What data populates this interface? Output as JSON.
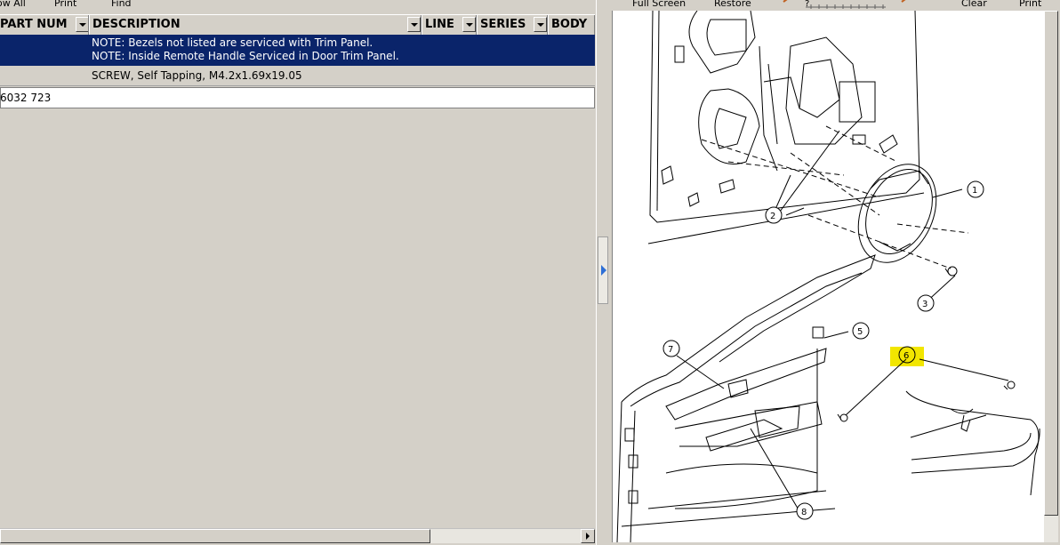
{
  "left_toolbar": {
    "show_all": "ow All",
    "print": "Print",
    "find": "Find"
  },
  "grid": {
    "columns": [
      "PART NUM",
      "DESCRIPTION",
      "LINE",
      "SERIES",
      "BODY"
    ],
    "rows": [
      {
        "part_num": "",
        "description_lines": [
          "NOTE: Bezels not listed are serviced with Trim Panel.",
          "NOTE: Inside Remote Handle Serviced in Door Trim Panel."
        ],
        "selected": true
      },
      {
        "part_num": "",
        "description_lines": [
          "SCREW, Self Tapping, M4.2x1.69x19.05"
        ],
        "selected": false
      }
    ],
    "input_value": "6032 723"
  },
  "right_toolbar": {
    "full_screen": "Full Screen",
    "restore": "Restore",
    "clear": "Clear",
    "print": "Print"
  },
  "diagram": {
    "callouts": [
      "1",
      "2",
      "3",
      "5",
      "6",
      "7",
      "8"
    ],
    "highlighted_callout": "6",
    "highlight_color": "#f2e600"
  },
  "colors": {
    "selection": "#0a246a",
    "chrome": "#d4d0c8",
    "splitter_arrow": "#2d6fd6"
  }
}
